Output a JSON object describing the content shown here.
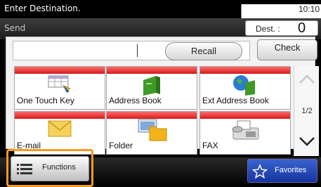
{
  "header": {
    "title": "Enter Destination.",
    "time": "10:10"
  },
  "subheader": {
    "mode": "Send",
    "dest_label": "Dest. :",
    "dest_count": "0"
  },
  "toolbar": {
    "recall_label": "Recall",
    "check_label": "Check"
  },
  "tiles": [
    {
      "label": "One Touch Key",
      "icon": "one-touch-key-icon"
    },
    {
      "label": "Address Book",
      "icon": "address-book-icon"
    },
    {
      "label": "Ext Address Book",
      "icon": "ext-address-book-icon"
    },
    {
      "label": "E-mail",
      "icon": "email-icon"
    },
    {
      "label": "Folder",
      "icon": "folder-icon"
    },
    {
      "label": "FAX",
      "icon": "fax-icon"
    }
  ],
  "pager": {
    "label": "1/2"
  },
  "bottom": {
    "functions_label": "Functions",
    "favorites_label": "Favorites"
  },
  "colors": {
    "accent_red": "#d61919",
    "highlight_orange": "#f39a21",
    "favorites_blue": "#1f45b8"
  }
}
